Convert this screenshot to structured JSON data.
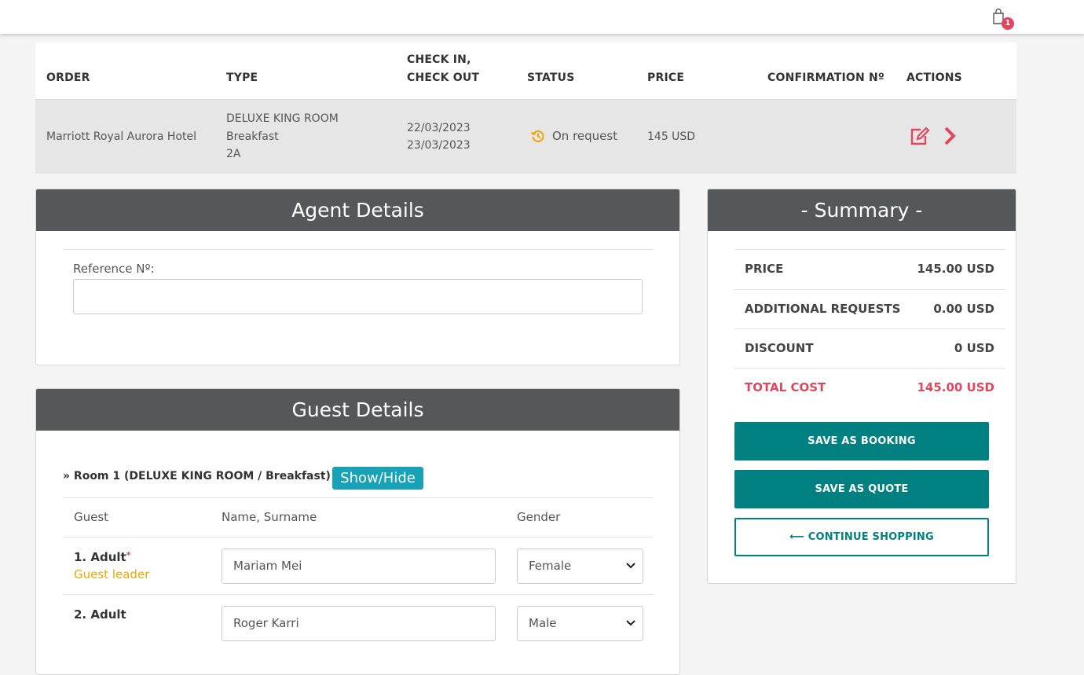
{
  "header": {
    "cart_count": "1"
  },
  "order_table": {
    "columns": {
      "order": "ORDER",
      "type": "TYPE",
      "checkin_line1": "CHECK IN,",
      "checkin_line2": "CHECK OUT",
      "status": "STATUS",
      "price": "PRICE",
      "confirmation": "CONFIRMATION Nº",
      "actions": "ACTIONS"
    },
    "row": {
      "hotel": "Marriott Royal Aurora Hotel",
      "room_type": "DELUXE KING ROOM",
      "board": "Breakfast",
      "occupancy": "2A",
      "check_in": "22/03/2023",
      "check_out": "23/03/2023",
      "status": "On request",
      "price": "145 USD",
      "confirmation": ""
    }
  },
  "agent_details": {
    "title": "Agent Details",
    "reference_label": "Reference Nº:",
    "reference_value": ""
  },
  "guest_details": {
    "title": "Guest Details",
    "room_title": "» Room 1 (DELUXE KING ROOM / Breakfast)",
    "toggle_label": "Show/Hide",
    "headers": {
      "guest": "Guest",
      "name": "Name, Surname",
      "gender": "Gender"
    },
    "guests": [
      {
        "label": "1. Adult",
        "required_mark": "*",
        "sub": "Guest leader",
        "name": "Mariam Mei",
        "gender": "Female"
      },
      {
        "label": "2. Adult",
        "name": "Roger Karri",
        "gender": "Male"
      }
    ]
  },
  "summary": {
    "title": "- Summary -",
    "rows": [
      {
        "label": "PRICE",
        "value": "145.00 USD"
      },
      {
        "label": "ADDITIONAL REQUESTS",
        "value": "0.00 USD"
      },
      {
        "label": "DISCOUNT",
        "value": "0 USD"
      },
      {
        "label": "TOTAL COST",
        "value": "145.00 USD"
      }
    ],
    "save_booking": "SAVE AS BOOKING",
    "save_quote": "SAVE AS QUOTE",
    "continue_arrow": "⟵",
    "continue_shopping": "CONTINUE SHOPPING"
  },
  "colors": {
    "accent_teal": "#008080",
    "danger": "#e0475e",
    "warning": "#f0a500",
    "panel_header": "#54585b",
    "toggle": "#17a2b8"
  },
  "icons": {
    "cart": "shopping-bag-icon",
    "status": "history-icon",
    "edit": "edit-icon",
    "next": "chevron-right-icon",
    "select": "chevron-down-icon"
  }
}
